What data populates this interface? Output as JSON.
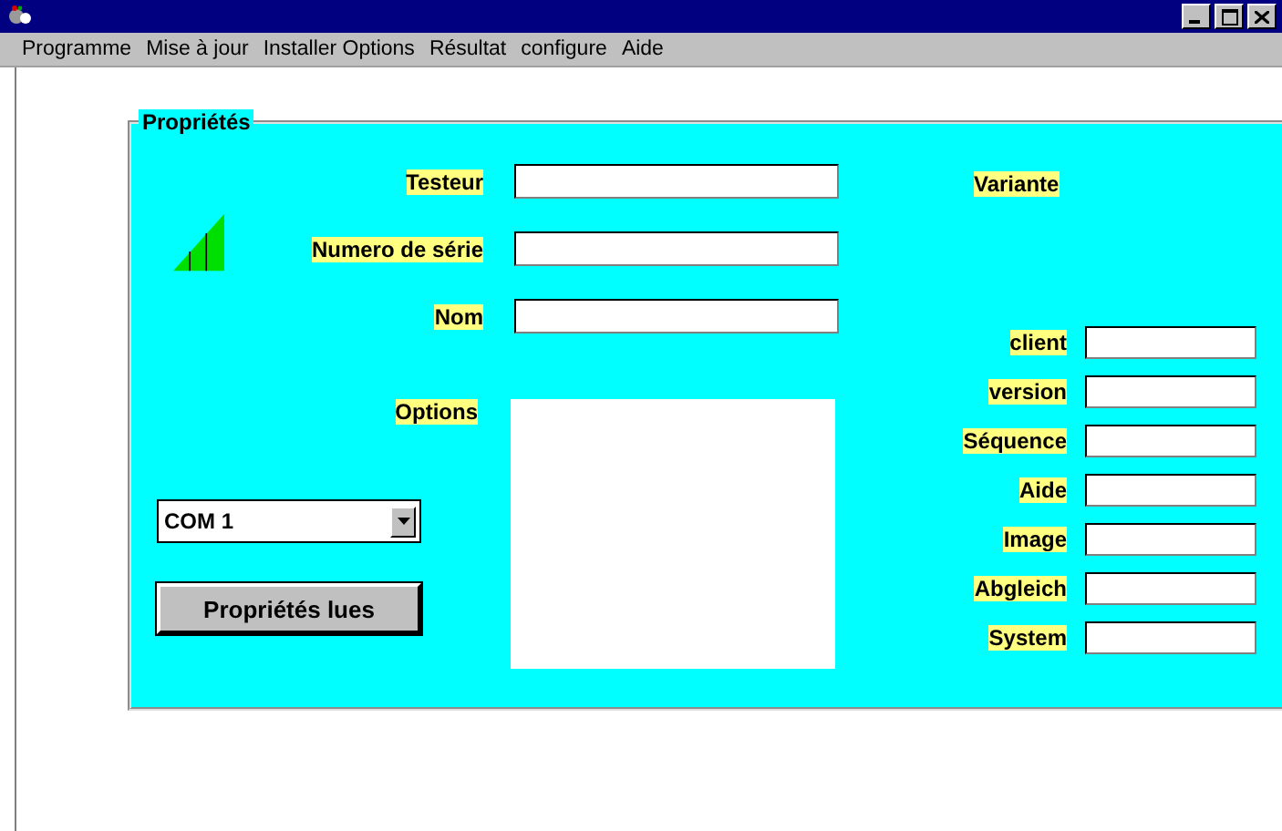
{
  "menu": [
    {
      "label": "Programme"
    },
    {
      "label": "Mise à jour"
    },
    {
      "label": "Installer Options"
    },
    {
      "label": "Résultat"
    },
    {
      "label": "configure"
    },
    {
      "label": "Aide"
    }
  ],
  "group": {
    "title": "Propriétés",
    "fields": [
      {
        "label": "Testeur"
      },
      {
        "label": "Numero de série"
      },
      {
        "label": "Nom"
      }
    ],
    "variant_label": "Variante",
    "variant_fields": [
      {
        "label": "client"
      },
      {
        "label": "version"
      },
      {
        "label": "Séquence"
      },
      {
        "label": "Aide"
      },
      {
        "label": "Image"
      },
      {
        "label": "Abgleich"
      },
      {
        "label": "System"
      }
    ],
    "options_label": "Options",
    "port_select": {
      "value": "COM 1"
    },
    "read_button": "Propriétés lues"
  }
}
